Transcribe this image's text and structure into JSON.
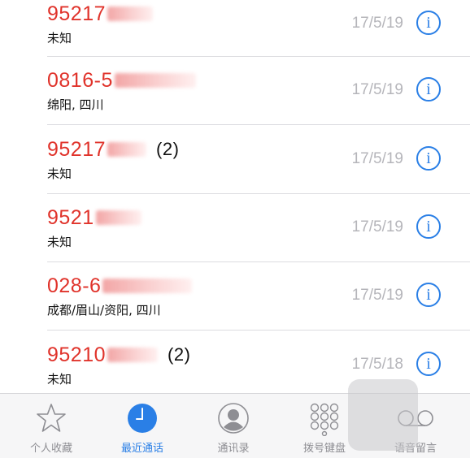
{
  "calls": [
    {
      "number": "95217",
      "count": "",
      "location": "未知",
      "date": "17/5/19"
    },
    {
      "number": "0816-5",
      "count": "",
      "location": "绵阳, 四川",
      "date": "17/5/19"
    },
    {
      "number": "95217",
      "count": "(2)",
      "location": "未知",
      "date": "17/5/19"
    },
    {
      "number": "9521",
      "count": "",
      "location": "未知",
      "date": "17/5/19"
    },
    {
      "number": "028-6",
      "count": "",
      "location": "成都/眉山/资阳, 四川",
      "date": "17/5/19"
    },
    {
      "number": "95210",
      "count": "(2)",
      "location": "未知",
      "date": "17/5/18"
    }
  ],
  "info_glyph": "i",
  "tabs": [
    {
      "label": "个人收藏",
      "icon": "star-icon",
      "active": false
    },
    {
      "label": "最近通话",
      "icon": "clock-icon",
      "active": true
    },
    {
      "label": "通讯录",
      "icon": "contacts-icon",
      "active": false
    },
    {
      "label": "拨号键盘",
      "icon": "keypad-icon",
      "active": false
    },
    {
      "label": "语音留言",
      "icon": "voicemail-icon",
      "active": false
    }
  ],
  "colors": {
    "missed": "#e0332b",
    "accent": "#2a7fe6",
    "muted": "#8e8e93"
  }
}
